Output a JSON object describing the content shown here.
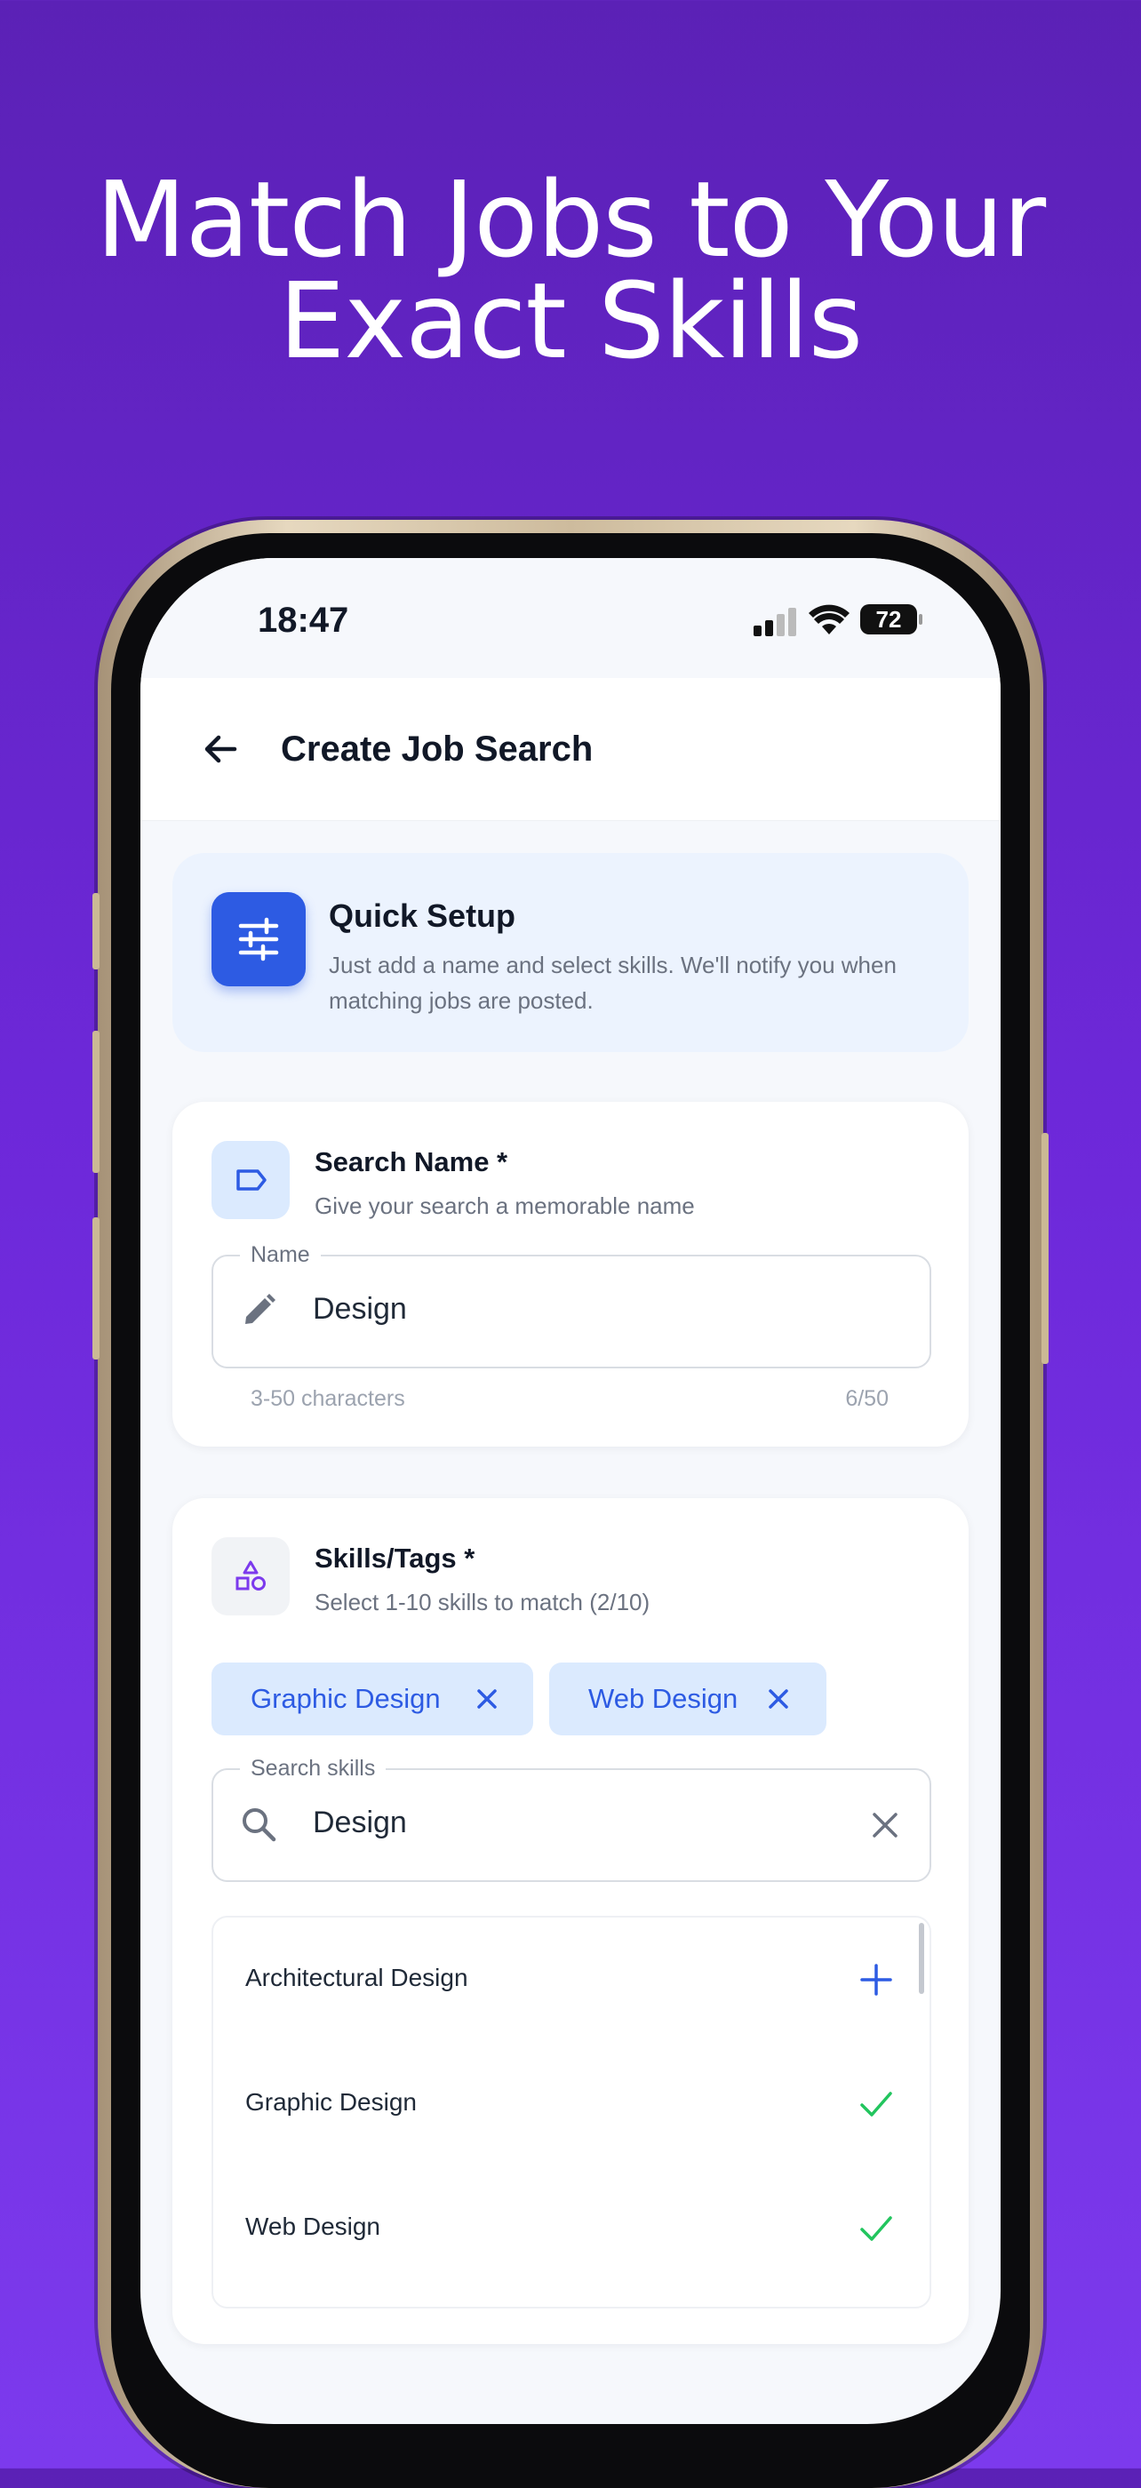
{
  "headline": {
    "line1": "Match Jobs to Your",
    "line2": "Exact Skills"
  },
  "status_bar": {
    "time": "18:47",
    "battery": "72"
  },
  "app_bar": {
    "title": "Create Job Search",
    "back_icon": "arrow-left-icon"
  },
  "quick_setup": {
    "title": "Quick Setup",
    "text": "Just add a name and select skills. We'll notify you when matching jobs are posted.",
    "icon": "sliders-icon"
  },
  "search_name": {
    "title": "Search Name *",
    "subtitle": "Give your search a memorable name",
    "field_label": "Name",
    "value": "Design",
    "helper": "3-50 characters",
    "counter": "6/50",
    "icon": "tag-icon",
    "field_icon": "pencil-icon"
  },
  "skills": {
    "title": "Skills/Tags *",
    "subtitle": "Select 1-10 skills to match (2/10)",
    "icon": "shapes-icon",
    "chips": [
      {
        "label": "Graphic Design"
      },
      {
        "label": "Web Design"
      }
    ],
    "search": {
      "label": "Search skills",
      "value": "Design"
    },
    "results": [
      {
        "label": "Architectural Design",
        "action": "add"
      },
      {
        "label": "Graphic Design",
        "action": "selected"
      },
      {
        "label": "Web Design",
        "action": "selected"
      }
    ]
  },
  "colors": {
    "accent": "#2d5be3",
    "check": "#22c55e",
    "background": "#6d28d9"
  }
}
